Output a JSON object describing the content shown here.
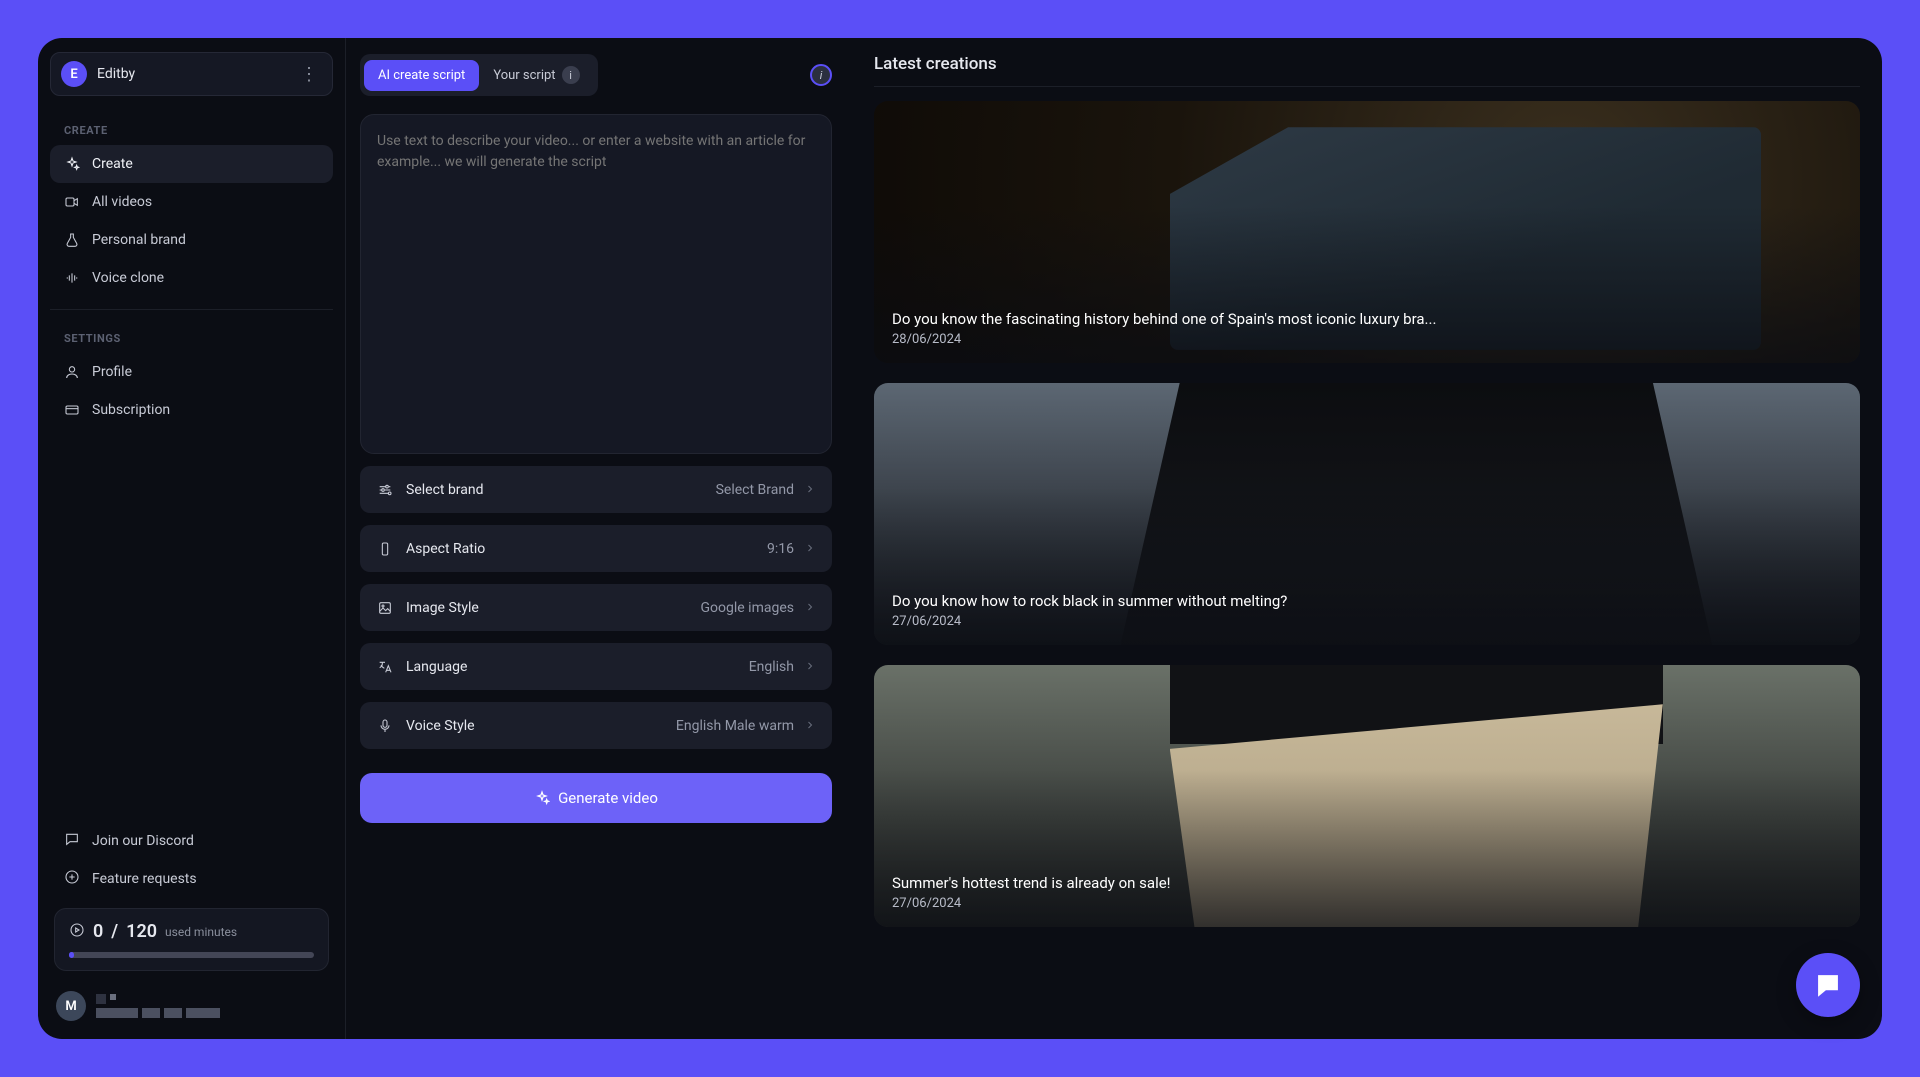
{
  "workspace": {
    "initial": "E",
    "name": "Editby"
  },
  "sidebar": {
    "labels": {
      "create": "CREATE",
      "settings": "SETTINGS"
    },
    "items": [
      {
        "label": "Create"
      },
      {
        "label": "All videos"
      },
      {
        "label": "Personal brand"
      },
      {
        "label": "Voice clone"
      }
    ],
    "settings": [
      {
        "label": "Profile"
      },
      {
        "label": "Subscription"
      }
    ],
    "footer": [
      {
        "label": "Join our Discord"
      },
      {
        "label": "Feature requests"
      }
    ]
  },
  "usage": {
    "used": "0",
    "sep": "/",
    "total": "120",
    "unit": "used minutes"
  },
  "user": {
    "initial": "M"
  },
  "tabs": {
    "ai": "AI create script",
    "your": "Your script"
  },
  "scriptPlaceholder": "Use text to describe your video... or enter a website with an article for example... we will generate the script",
  "options": {
    "brand": {
      "label": "Select brand",
      "value": "Select Brand"
    },
    "aspect": {
      "label": "Aspect Ratio",
      "value": "9:16"
    },
    "image": {
      "label": "Image Style",
      "value": "Google images"
    },
    "lang": {
      "label": "Language",
      "value": "English"
    },
    "voice": {
      "label": "Voice Style",
      "value": "English Male warm"
    }
  },
  "generate": "Generate video",
  "latest": {
    "heading": "Latest creations",
    "cards": [
      {
        "title": "Do you know the fascinating history behind one of Spain's most iconic luxury bra...",
        "date": "28/06/2024"
      },
      {
        "title": "Do you know how to rock black in summer without melting?",
        "date": "27/06/2024"
      },
      {
        "title": "Summer's hottest trend is already on sale!",
        "date": "27/06/2024"
      }
    ]
  }
}
